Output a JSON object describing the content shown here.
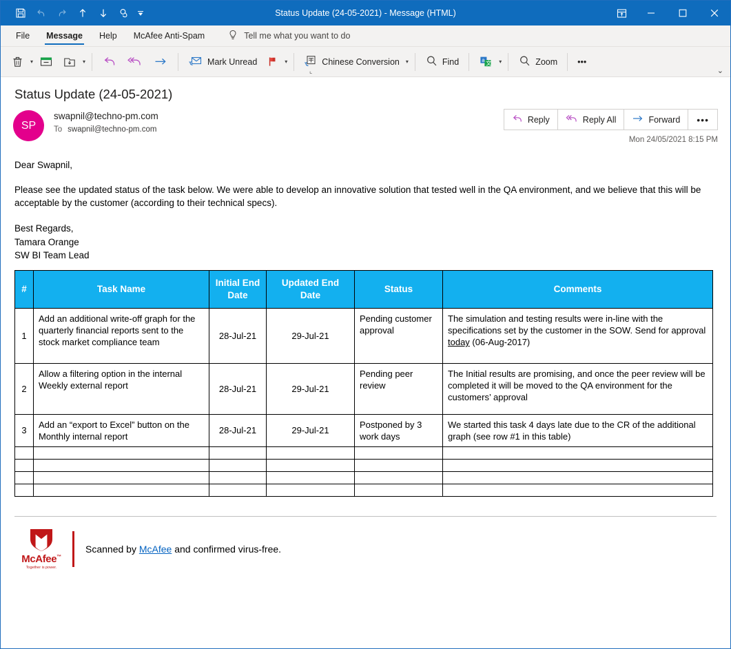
{
  "titlebar": {
    "title": "Status Update (24-05-2021)  -  Message (HTML)",
    "qat": [
      {
        "name": "save-icon",
        "label": "Save"
      },
      {
        "name": "undo-icon",
        "label": "Undo"
      },
      {
        "name": "redo-icon",
        "label": "Redo"
      },
      {
        "name": "previous-item-icon",
        "label": "Previous Item"
      },
      {
        "name": "next-item-icon",
        "label": "Next Item"
      },
      {
        "name": "touch-mode-icon",
        "label": "Touch/Mouse Mode"
      },
      {
        "name": "customize-quick-access-toolbar-icon",
        "label": "Customize Quick Access Toolbar"
      }
    ],
    "window_controls": [
      {
        "name": "ribbon-display-options-icon",
        "label": "Ribbon Display Options"
      },
      {
        "name": "minimize-icon",
        "label": "Minimize"
      },
      {
        "name": "maximize-icon",
        "label": "Maximize"
      },
      {
        "name": "close-icon",
        "label": "Close"
      }
    ]
  },
  "tabs": [
    {
      "label": "File",
      "active": false
    },
    {
      "label": "Message",
      "active": true
    },
    {
      "label": "Help",
      "active": false
    },
    {
      "label": "McAfee Anti-Spam",
      "active": false
    }
  ],
  "tellme": {
    "icon": "lightbulb-icon",
    "placeholder": "Tell me what you want to do"
  },
  "ribbon": {
    "delete_label": "Delete",
    "archive_label": "Archive",
    "move_label": "Move",
    "reply_label": "Reply",
    "reply_all_label": "Reply All",
    "forward_label": "Forward",
    "mark_unread_label": "Mark Unread",
    "flag_label": "Follow Up",
    "chinese_conversion_label": "Chinese Conversion",
    "find_label": "Find",
    "translate_label": "Translate",
    "zoom_label": "Zoom",
    "more_label": "•••",
    "collapse_label": "⌄"
  },
  "message": {
    "subject": "Status Update (24-05-2021)",
    "avatar_initials": "SP",
    "from": "swapnil@techno-pm.com",
    "to_label": "To",
    "to": "swapnil@techno-pm.com",
    "received": "Mon 24/05/2021 8:15 PM",
    "actions": [
      {
        "label": "Reply",
        "icon": "reply-icon"
      },
      {
        "label": "Reply All",
        "icon": "reply-all-icon"
      },
      {
        "label": "Forward",
        "icon": "forward-icon"
      },
      {
        "label": "•••",
        "icon": "more-actions-icon"
      }
    ]
  },
  "body": {
    "greeting": "Dear Swapnil,",
    "paragraph": "Please see the updated status of the task below. We were able to develop an innovative solution that tested well in the QA environment, and we believe that this will be acceptable by the customer (according to their technical specs).",
    "sign_off": "Best Regards,",
    "sender_name": "Tamara Orange",
    "sender_title": "SW BI Team Lead"
  },
  "table": {
    "header_bg": "#13b0ef",
    "headers": [
      "#",
      "Task Name",
      "Initial End Date",
      "Updated End Date",
      "Status",
      "Comments"
    ],
    "rows": [
      {
        "num": "1",
        "task": "Add an additional write-off graph for the quarterly financial reports sent to the stock market compliance team",
        "initial_end_date": "28-Jul-21",
        "updated_end_date": "29-Jul-21",
        "status": "Pending customer approval",
        "comment_pre": "The simulation and testing results were in-line with the specifications set by the customer in the SOW. Send for approval ",
        "comment_underlined": "today",
        "comment_post": " (06-Aug-2017)"
      },
      {
        "num": "2",
        "task": "Allow a filtering option in the internal Weekly external report",
        "initial_end_date": "28-Jul-21",
        "updated_end_date": "29-Jul-21",
        "status": "Pending peer review",
        "comment_pre": "The Initial results are promising, and once the peer review will be completed it will be moved to the QA environment for the customers’ approval",
        "comment_underlined": "",
        "comment_post": ""
      },
      {
        "num": "3",
        "task": "Add an “export to Excel” button on the Monthly internal report",
        "initial_end_date": "28-Jul-21",
        "updated_end_date": "29-Jul-21",
        "status": "Postponed by 3 work days",
        "comment_pre": "We started this task 4 days late due to the CR of the additional graph (see row #1 in this table)",
        "comment_underlined": "",
        "comment_post": ""
      }
    ],
    "empty_row_count": 4
  },
  "footer": {
    "logo_word": "McAfee",
    "logo_tm": "™",
    "logo_tagline": "Together is power.",
    "scanned_pre": "Scanned by ",
    "scanned_link": "McAfee",
    "scanned_post": " and confirmed virus-free."
  }
}
